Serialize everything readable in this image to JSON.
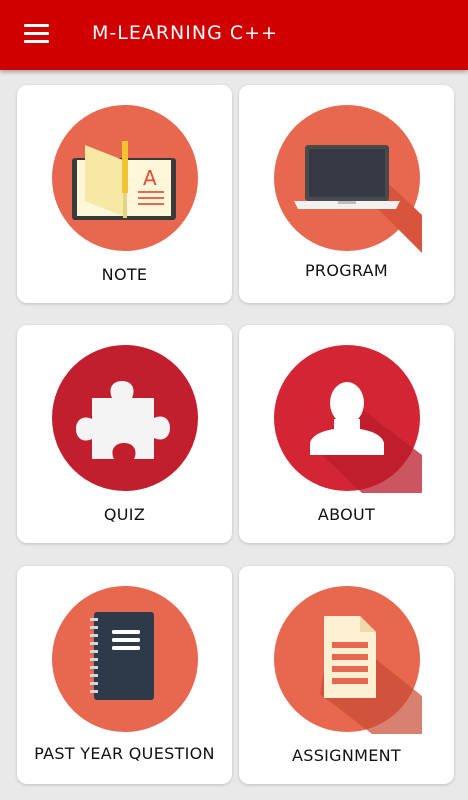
{
  "appbar": {
    "title": "M-LEARNING C++",
    "menu_icon": "hamburger-menu-icon",
    "color": "#d00000"
  },
  "menu": [
    {
      "label": "NOTE",
      "icon": "open-book-icon"
    },
    {
      "label": "PROGRAM",
      "icon": "laptop-icon"
    },
    {
      "label": "QUIZ",
      "icon": "puzzle-piece-icon"
    },
    {
      "label": "ABOUT",
      "icon": "user-icon"
    },
    {
      "label": "PAST YEAR QUESTION",
      "icon": "notebook-icon"
    },
    {
      "label": "ASSIGNMENT",
      "icon": "document-icon"
    }
  ],
  "note_icon_letter": "A",
  "colors": {
    "circle_coral": "#e8674f",
    "circle_red": "#d42535",
    "circle_crimson": "#c21f2e",
    "card_bg": "#ffffff",
    "page_bg": "#e9e9e9"
  }
}
